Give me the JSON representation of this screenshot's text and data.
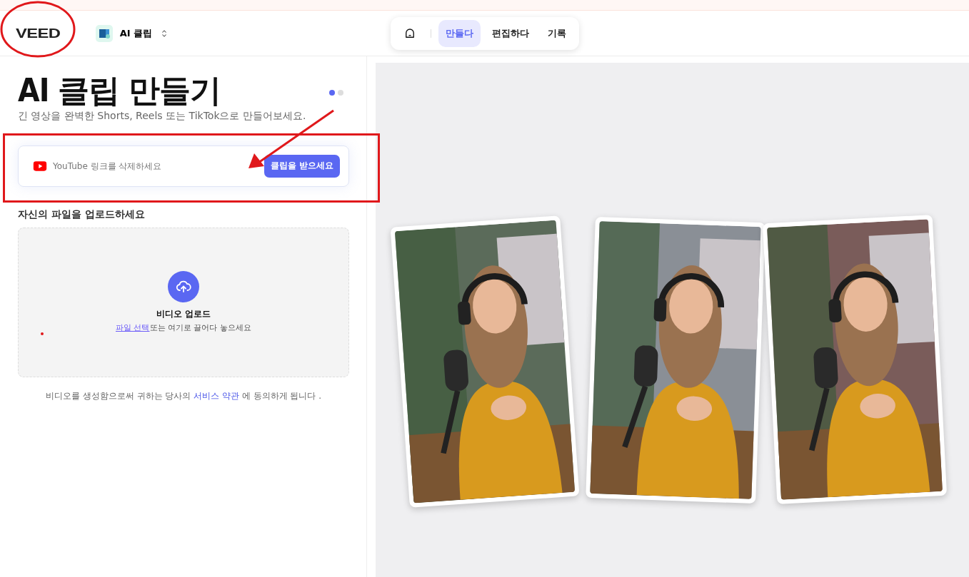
{
  "header": {
    "logo": "VEED",
    "product": {
      "label": "AI 클립"
    },
    "nav": [
      {
        "kind": "home",
        "selected": false
      },
      {
        "kind": "text",
        "label": "만들다",
        "selected": true
      },
      {
        "kind": "text",
        "label": "편집하다",
        "selected": false
      },
      {
        "kind": "text",
        "label": "기록",
        "selected": false
      }
    ]
  },
  "panel": {
    "title": "AI 클립 만들기",
    "subtitle": "긴 영상을 완벽한 Shorts, Reels 또는 TikTok으로 만들어보세요.",
    "pager": [
      {
        "selected": true
      },
      {
        "selected": false
      }
    ],
    "link_field": {
      "placeholder": "YouTube 링크를 삭제하세요",
      "button": "클립을 받으세요"
    },
    "upload": {
      "heading": "자신의 파일을 업로드하세요",
      "title": "비디오 업로드",
      "link": "파일 선택",
      "hint": "또는 여기로 끌어다 놓으세요"
    },
    "terms": {
      "before": "비디오를 생성함으로써 귀하는 당사의",
      "link": "서비스 약관",
      "after": "에 동의하게 됩니다 ."
    }
  },
  "annotations": [
    {
      "kind": "ellipse"
    },
    {
      "kind": "box"
    },
    {
      "kind": "arrow"
    },
    {
      "kind": "dot"
    }
  ]
}
